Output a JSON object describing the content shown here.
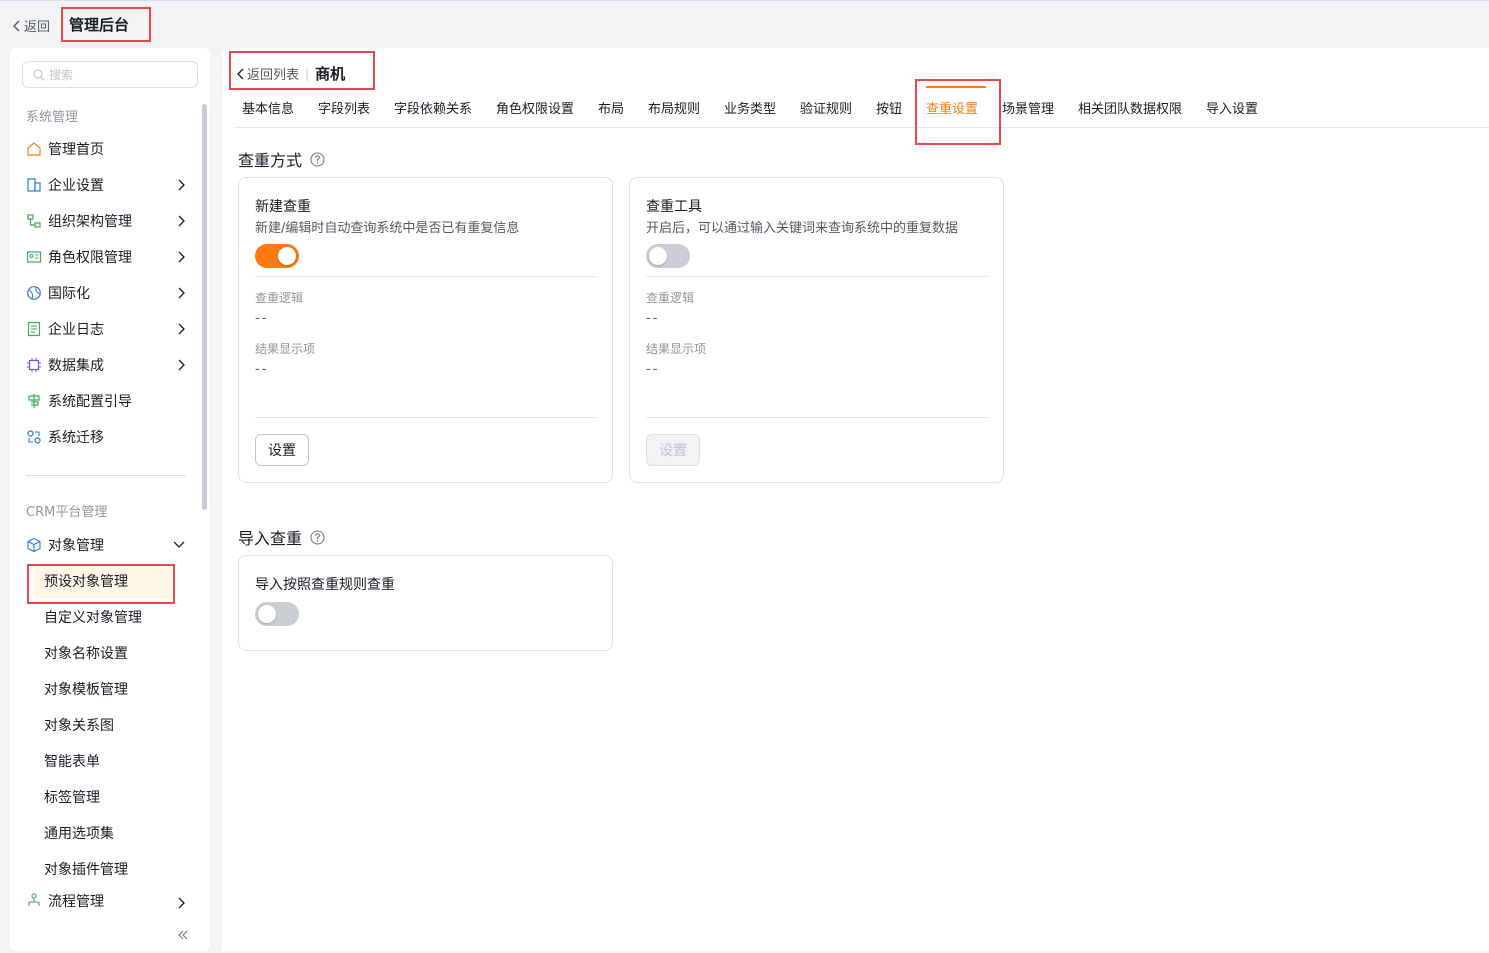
{
  "topbar": {
    "back": "返回",
    "title": "管理后台"
  },
  "sidebar": {
    "search_placeholder": "搜索",
    "group1": "系统管理",
    "items": [
      {
        "label": "管理首页",
        "icon": "home-icon"
      },
      {
        "label": "企业设置",
        "icon": "enterprise-icon"
      },
      {
        "label": "组织架构管理",
        "icon": "org-icon"
      },
      {
        "label": "角色权限管理",
        "icon": "role-icon"
      },
      {
        "label": "国际化",
        "icon": "globe-icon"
      },
      {
        "label": "企业日志",
        "icon": "log-icon"
      },
      {
        "label": "数据集成",
        "icon": "chip-icon"
      },
      {
        "label": "系统配置引导",
        "icon": "signpost-icon"
      },
      {
        "label": "系统迁移",
        "icon": "migrate-icon"
      }
    ],
    "group2": "CRM平台管理",
    "object_mgmt": "对象管理",
    "sub_items": [
      "预设对象管理",
      "自定义对象管理",
      "对象名称设置",
      "对象模板管理",
      "对象关系图",
      "智能表单",
      "标签管理",
      "通用选项集",
      "对象插件管理"
    ],
    "flow_mgmt": "流程管理"
  },
  "main": {
    "back_to_list": "返回列表",
    "object_name": "商机",
    "tabs": [
      "基本信息",
      "字段列表",
      "字段依赖关系",
      "角色权限设置",
      "布局",
      "布局规则",
      "业务类型",
      "验证规则",
      "按钮",
      "查重设置",
      "场景管理",
      "相关团队数据权限",
      "导入设置"
    ],
    "active_tab": "查重设置",
    "section1": "查重方式",
    "card_new": {
      "title": "新建查重",
      "desc": "新建/编辑时自动查询系统中是否已有重复信息",
      "enabled": true,
      "logic_label": "查重逻辑",
      "logic_value": "--",
      "result_label": "结果显示项",
      "result_value": "--",
      "button": "设置"
    },
    "card_tool": {
      "title": "查重工具",
      "desc": "开启后，可以通过输入关键词来查询系统中的重复数据",
      "enabled": false,
      "logic_label": "查重逻辑",
      "logic_value": "--",
      "result_label": "结果显示项",
      "result_value": "--",
      "button": "设置"
    },
    "section2": "导入查重",
    "card_import": {
      "title": "导入按照查重规则查重",
      "enabled": false
    }
  },
  "colors": {
    "accent": "#ff7a12",
    "highlight": "#e5484d"
  }
}
